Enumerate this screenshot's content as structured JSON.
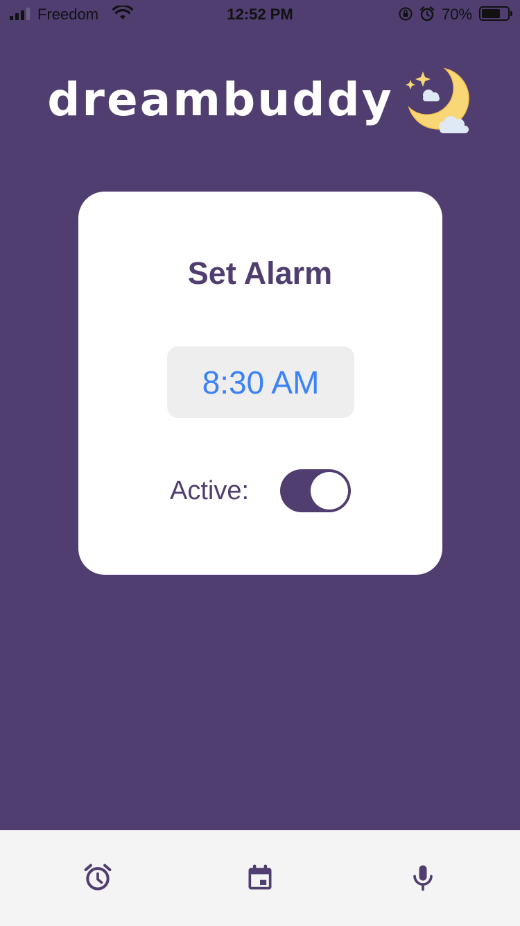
{
  "status_bar": {
    "carrier": "Freedom",
    "time": "12:52 PM",
    "battery_percent": "70%",
    "battery_level": 0.7,
    "icons": [
      "signal-icon",
      "wifi-icon",
      "orientation-lock-icon",
      "alarm-icon",
      "battery-icon"
    ]
  },
  "logo": {
    "text": "dreambuddy",
    "icon": "moon-stars-clouds-icon"
  },
  "alarm_card": {
    "title": "Set Alarm",
    "time_value": "8:30 AM",
    "active_label": "Active:",
    "active": true
  },
  "bottom_nav": {
    "items": [
      {
        "icon": "alarm-clock-icon"
      },
      {
        "icon": "calendar-icon"
      },
      {
        "icon": "microphone-icon"
      }
    ]
  },
  "colors": {
    "background": "#4f3e6f",
    "card": "#ffffff",
    "accent": "#4f3e6f",
    "time_text": "#3b82f6",
    "time_picker_bg": "#eeeeee",
    "nav_bg": "#f4f4f4"
  }
}
